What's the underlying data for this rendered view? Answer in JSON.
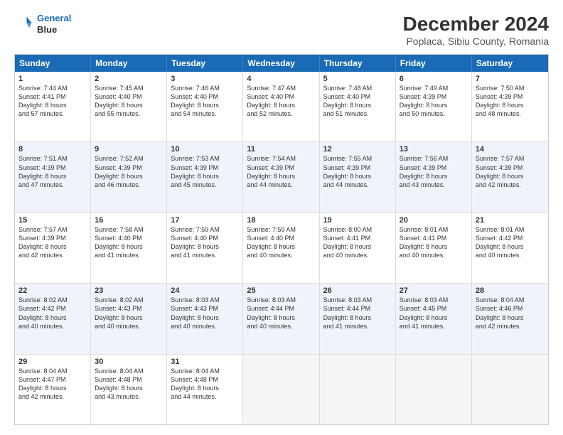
{
  "header": {
    "logo_line1": "General",
    "logo_line2": "Blue",
    "main_title": "December 2024",
    "subtitle": "Poplaca, Sibiu County, Romania"
  },
  "weekdays": [
    "Sunday",
    "Monday",
    "Tuesday",
    "Wednesday",
    "Thursday",
    "Friday",
    "Saturday"
  ],
  "rows": [
    [
      {
        "day": "1",
        "lines": [
          "Sunrise: 7:44 AM",
          "Sunset: 4:41 PM",
          "Daylight: 8 hours",
          "and 57 minutes."
        ]
      },
      {
        "day": "2",
        "lines": [
          "Sunrise: 7:45 AM",
          "Sunset: 4:40 PM",
          "Daylight: 8 hours",
          "and 55 minutes."
        ]
      },
      {
        "day": "3",
        "lines": [
          "Sunrise: 7:46 AM",
          "Sunset: 4:40 PM",
          "Daylight: 8 hours",
          "and 54 minutes."
        ]
      },
      {
        "day": "4",
        "lines": [
          "Sunrise: 7:47 AM",
          "Sunset: 4:40 PM",
          "Daylight: 8 hours",
          "and 52 minutes."
        ]
      },
      {
        "day": "5",
        "lines": [
          "Sunrise: 7:48 AM",
          "Sunset: 4:40 PM",
          "Daylight: 8 hours",
          "and 51 minutes."
        ]
      },
      {
        "day": "6",
        "lines": [
          "Sunrise: 7:49 AM",
          "Sunset: 4:39 PM",
          "Daylight: 8 hours",
          "and 50 minutes."
        ]
      },
      {
        "day": "7",
        "lines": [
          "Sunrise: 7:50 AM",
          "Sunset: 4:39 PM",
          "Daylight: 8 hours",
          "and 48 minutes."
        ]
      }
    ],
    [
      {
        "day": "8",
        "lines": [
          "Sunrise: 7:51 AM",
          "Sunset: 4:39 PM",
          "Daylight: 8 hours",
          "and 47 minutes."
        ]
      },
      {
        "day": "9",
        "lines": [
          "Sunrise: 7:52 AM",
          "Sunset: 4:39 PM",
          "Daylight: 8 hours",
          "and 46 minutes."
        ]
      },
      {
        "day": "10",
        "lines": [
          "Sunrise: 7:53 AM",
          "Sunset: 4:39 PM",
          "Daylight: 8 hours",
          "and 45 minutes."
        ]
      },
      {
        "day": "11",
        "lines": [
          "Sunrise: 7:54 AM",
          "Sunset: 4:39 PM",
          "Daylight: 8 hours",
          "and 44 minutes."
        ]
      },
      {
        "day": "12",
        "lines": [
          "Sunrise: 7:55 AM",
          "Sunset: 4:39 PM",
          "Daylight: 8 hours",
          "and 44 minutes."
        ]
      },
      {
        "day": "13",
        "lines": [
          "Sunrise: 7:56 AM",
          "Sunset: 4:39 PM",
          "Daylight: 8 hours",
          "and 43 minutes."
        ]
      },
      {
        "day": "14",
        "lines": [
          "Sunrise: 7:57 AM",
          "Sunset: 4:39 PM",
          "Daylight: 8 hours",
          "and 42 minutes."
        ]
      }
    ],
    [
      {
        "day": "15",
        "lines": [
          "Sunrise: 7:57 AM",
          "Sunset: 4:39 PM",
          "Daylight: 8 hours",
          "and 42 minutes."
        ]
      },
      {
        "day": "16",
        "lines": [
          "Sunrise: 7:58 AM",
          "Sunset: 4:40 PM",
          "Daylight: 8 hours",
          "and 41 minutes."
        ]
      },
      {
        "day": "17",
        "lines": [
          "Sunrise: 7:59 AM",
          "Sunset: 4:40 PM",
          "Daylight: 8 hours",
          "and 41 minutes."
        ]
      },
      {
        "day": "18",
        "lines": [
          "Sunrise: 7:59 AM",
          "Sunset: 4:40 PM",
          "Daylight: 8 hours",
          "and 40 minutes."
        ]
      },
      {
        "day": "19",
        "lines": [
          "Sunrise: 8:00 AM",
          "Sunset: 4:41 PM",
          "Daylight: 8 hours",
          "and 40 minutes."
        ]
      },
      {
        "day": "20",
        "lines": [
          "Sunrise: 8:01 AM",
          "Sunset: 4:41 PM",
          "Daylight: 8 hours",
          "and 40 minutes."
        ]
      },
      {
        "day": "21",
        "lines": [
          "Sunrise: 8:01 AM",
          "Sunset: 4:42 PM",
          "Daylight: 8 hours",
          "and 40 minutes."
        ]
      }
    ],
    [
      {
        "day": "22",
        "lines": [
          "Sunrise: 8:02 AM",
          "Sunset: 4:42 PM",
          "Daylight: 8 hours",
          "and 40 minutes."
        ]
      },
      {
        "day": "23",
        "lines": [
          "Sunrise: 8:02 AM",
          "Sunset: 4:43 PM",
          "Daylight: 8 hours",
          "and 40 minutes."
        ]
      },
      {
        "day": "24",
        "lines": [
          "Sunrise: 8:03 AM",
          "Sunset: 4:43 PM",
          "Daylight: 8 hours",
          "and 40 minutes."
        ]
      },
      {
        "day": "25",
        "lines": [
          "Sunrise: 8:03 AM",
          "Sunset: 4:44 PM",
          "Daylight: 8 hours",
          "and 40 minutes."
        ]
      },
      {
        "day": "26",
        "lines": [
          "Sunrise: 8:03 AM",
          "Sunset: 4:44 PM",
          "Daylight: 8 hours",
          "and 41 minutes."
        ]
      },
      {
        "day": "27",
        "lines": [
          "Sunrise: 8:03 AM",
          "Sunset: 4:45 PM",
          "Daylight: 8 hours",
          "and 41 minutes."
        ]
      },
      {
        "day": "28",
        "lines": [
          "Sunrise: 8:04 AM",
          "Sunset: 4:46 PM",
          "Daylight: 8 hours",
          "and 42 minutes."
        ]
      }
    ],
    [
      {
        "day": "29",
        "lines": [
          "Sunrise: 8:04 AM",
          "Sunset: 4:47 PM",
          "Daylight: 8 hours",
          "and 42 minutes."
        ]
      },
      {
        "day": "30",
        "lines": [
          "Sunrise: 8:04 AM",
          "Sunset: 4:48 PM",
          "Daylight: 8 hours",
          "and 43 minutes."
        ]
      },
      {
        "day": "31",
        "lines": [
          "Sunrise: 8:04 AM",
          "Sunset: 4:48 PM",
          "Daylight: 8 hours",
          "and 44 minutes."
        ]
      },
      {
        "day": "",
        "lines": []
      },
      {
        "day": "",
        "lines": []
      },
      {
        "day": "",
        "lines": []
      },
      {
        "day": "",
        "lines": []
      }
    ]
  ],
  "row_alt": [
    false,
    true,
    false,
    true,
    false
  ]
}
